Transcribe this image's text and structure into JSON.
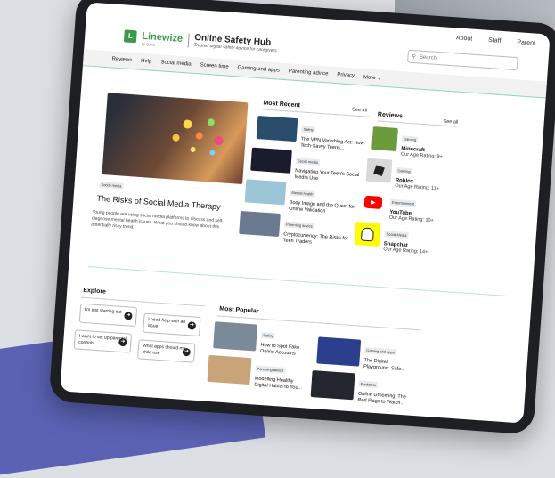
{
  "header": {
    "top_links": [
      "About",
      "Staff",
      "Parent"
    ],
    "logo_text": "Linewize",
    "logo_sub": "by Qoria",
    "site_title": "Online Safety Hub",
    "site_subtitle": "Trusted digital safety advice for caregivers",
    "search_placeholder": "Search"
  },
  "nav": [
    "Reviews",
    "Help",
    "Social media",
    "Screen time",
    "Gaming and apps",
    "Parenting advice",
    "Privacy",
    "More ⌄"
  ],
  "hero": {
    "tag": "Social media",
    "title": "The Risks of Social Media Therapy",
    "description": "Young people are using social media platforms to discuss and self-diagnose mental health issues. What you should know about this potentially risky trend."
  },
  "most_recent": {
    "heading": "Most Recent",
    "see_all": "See all",
    "items": [
      {
        "tag": "Safety",
        "title": "The VPN Vanishing Act: How Tech-Savvy Teens...",
        "color": "#2a4d6e"
      },
      {
        "tag": "Social media",
        "title": "Navigating Your Teen's Social Media Use",
        "color": "#1b1b2e"
      },
      {
        "tag": "Mental health",
        "title": "Body Image and the Quest for Online Validation",
        "color": "#9ac6d8"
      },
      {
        "tag": "Parenting advice",
        "title": "Cryptocurrency: The Risks for Teen Traders",
        "color": "#6b7a8f"
      }
    ]
  },
  "reviews": {
    "heading": "Reviews",
    "see_all": "See all",
    "items": [
      {
        "tag": "Gaming",
        "title": "Minecraft",
        "rating": "Our Age Rating: 9+",
        "color": "#6b9b3a"
      },
      {
        "tag": "Gaming",
        "title": "Roblox",
        "rating": "Our Age Rating: 11+",
        "color": "#d9d9d9"
      },
      {
        "tag": "Entertainment",
        "title": "YouTube",
        "rating": "Our Age Rating: 10+",
        "color": "#ff0000"
      },
      {
        "tag": "Social Media",
        "title": "Snapchat",
        "rating": "Our Age Rating: 14+",
        "color": "#fffc00"
      }
    ]
  },
  "explore": {
    "heading": "Explore",
    "buttons": [
      "I'm just starting out",
      "I need help with an issue",
      "I want to set up parental controls",
      "What apps should my child use"
    ]
  },
  "most_popular": {
    "heading": "Most Popular",
    "items": [
      {
        "tag": "Safety",
        "title": "How to Spot Fake Online Accounts",
        "color": "#7b8a99"
      },
      {
        "tag": "Gaming and apps",
        "title": "The Digital Playground: Safe...",
        "color": "#2b3f8c"
      },
      {
        "tag": "Parenting advice",
        "title": "Modelling Healthy Digital Habits to You...",
        "color": "#c9a37a"
      },
      {
        "tag": "Predators",
        "title": "Online Grooming: The Red Flags to Watch...",
        "color": "#23262e"
      }
    ]
  },
  "colors": {
    "brand_green": "#3a9c48",
    "accent_teal": "#8fd3c3",
    "backdrop_purple": "#5b62b4"
  }
}
